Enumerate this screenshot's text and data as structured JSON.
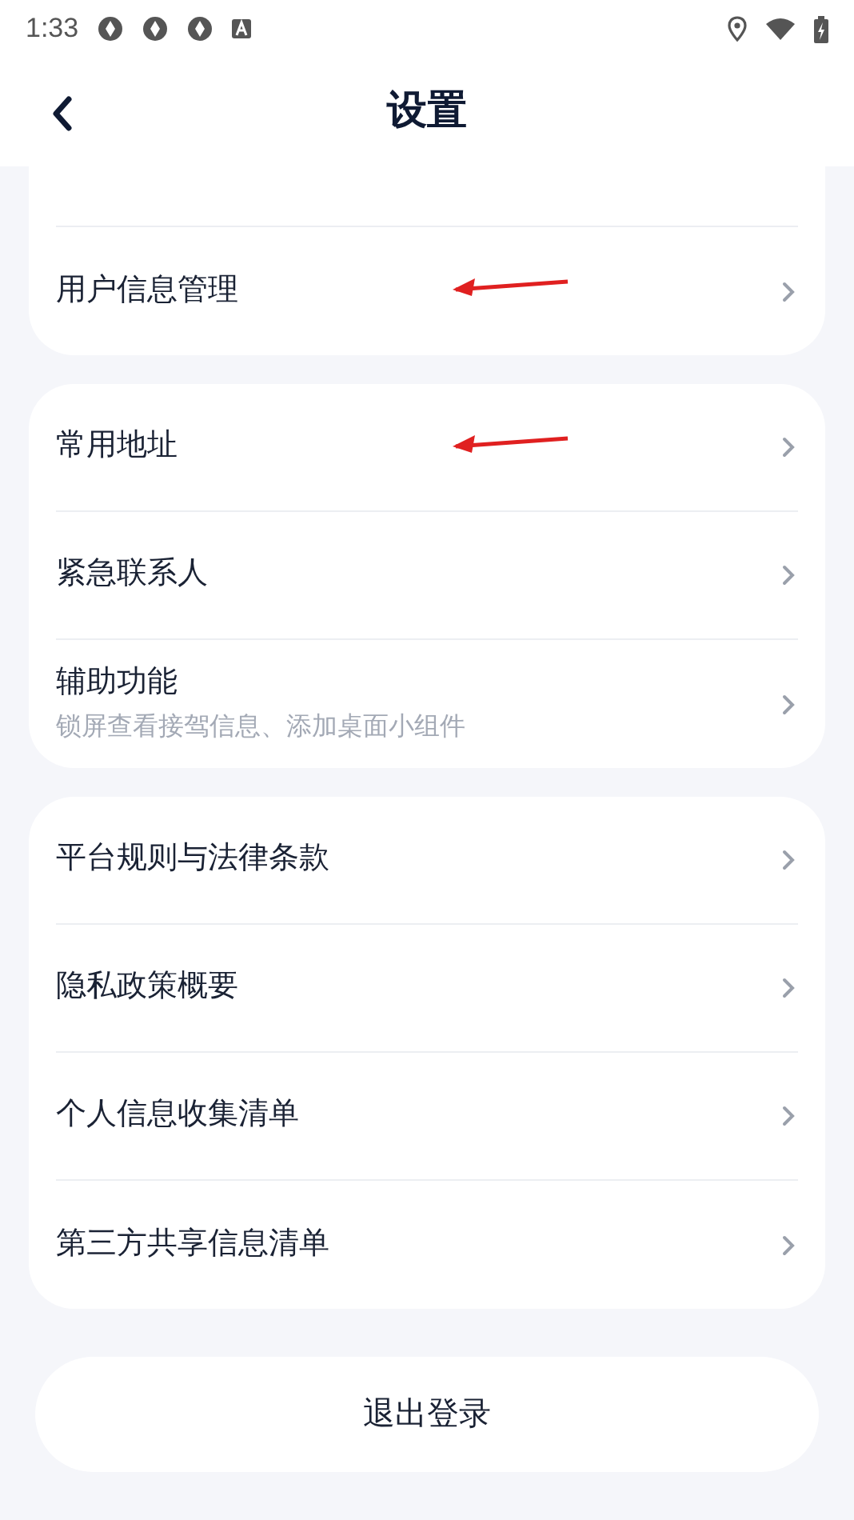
{
  "status_bar": {
    "time": "1:33"
  },
  "header": {
    "title": "设置"
  },
  "groups": [
    {
      "cut_top": true,
      "items": [
        {
          "label": "用户信息管理",
          "annotated": true
        }
      ]
    },
    {
      "cut_top": false,
      "items": [
        {
          "label": "常用地址",
          "annotated": true
        },
        {
          "label": "紧急联系人",
          "annotated": false
        },
        {
          "label": "辅助功能",
          "subtitle": "锁屏查看接驾信息、添加桌面小组件",
          "annotated": false
        }
      ]
    },
    {
      "cut_top": false,
      "items": [
        {
          "label": "平台规则与法律条款",
          "annotated": false
        },
        {
          "label": "隐私政策概要",
          "annotated": false
        },
        {
          "label": "个人信息收集清单",
          "annotated": false
        },
        {
          "label": "第三方共享信息清单",
          "annotated": false
        }
      ]
    }
  ],
  "logout_button": "退出登录"
}
